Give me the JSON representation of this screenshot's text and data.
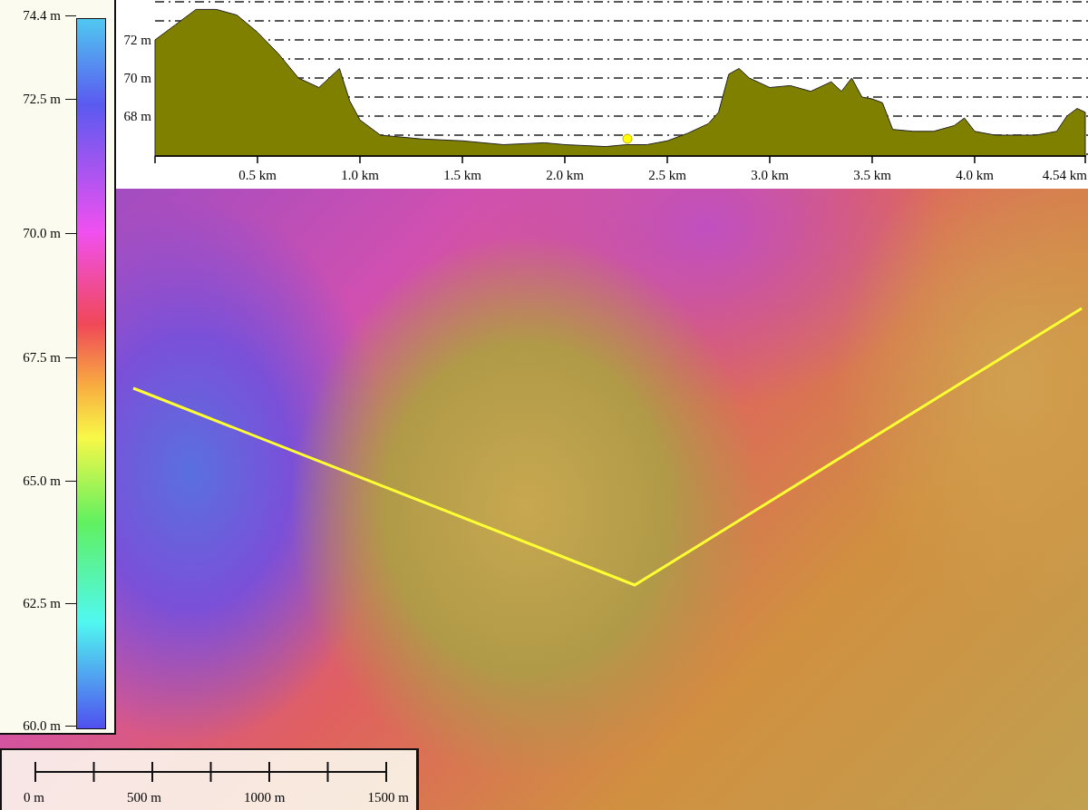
{
  "legend": {
    "labels": [
      "74.4 m",
      "72.5 m",
      "70.0 m",
      "67.5 m",
      "65.0 m",
      "62.5 m",
      "60.0 m"
    ]
  },
  "profile": {
    "chart_data": {
      "type": "area",
      "xlim": [
        0,
        4.54
      ],
      "ylim": [
        65.9,
        74.1
      ],
      "x": [
        0,
        0.1,
        0.2,
        0.3,
        0.4,
        0.5,
        0.6,
        0.7,
        0.8,
        0.9,
        0.95,
        1.0,
        1.1,
        1.2,
        1.3,
        1.5,
        1.7,
        1.9,
        2.0,
        2.2,
        2.3,
        2.4,
        2.5,
        2.6,
        2.7,
        2.75,
        2.8,
        2.85,
        2.9,
        3.0,
        3.1,
        3.2,
        3.3,
        3.35,
        3.4,
        3.45,
        3.5,
        3.55,
        3.6,
        3.7,
        3.8,
        3.9,
        3.95,
        4.0,
        4.1,
        4.2,
        4.3,
        4.4,
        4.45,
        4.5,
        4.54
      ],
      "series": [
        {
          "color": "#808000",
          "values": [
            72.0,
            72.8,
            73.6,
            73.6,
            73.3,
            72.4,
            71.3,
            70.0,
            69.5,
            70.5,
            68.8,
            67.8,
            67.0,
            66.9,
            66.8,
            66.7,
            66.5,
            66.6,
            66.5,
            66.4,
            66.5,
            66.5,
            66.7,
            67.1,
            67.6,
            68.2,
            70.2,
            70.5,
            70.0,
            69.5,
            69.6,
            69.3,
            69.8,
            69.3,
            70.0,
            69.0,
            68.9,
            68.7,
            67.3,
            67.2,
            67.2,
            67.5,
            67.9,
            67.2,
            67.0,
            67.0,
            67.0,
            67.2,
            68.0,
            68.4,
            68.2
          ]
        }
      ],
      "yticks": [
        {
          "value": 68,
          "label": "68 m"
        },
        {
          "value": 70,
          "label": "70 m"
        },
        {
          "value": 72,
          "label": "72 m"
        }
      ],
      "grid": true,
      "xticks": [
        {
          "value": 0.5,
          "label": "0.5 km"
        },
        {
          "value": 1.0,
          "label": "1.0 km"
        },
        {
          "value": 1.5,
          "label": "1.5 km"
        },
        {
          "value": 2.0,
          "label": "2.0 km"
        },
        {
          "value": 2.5,
          "label": "2.5 km"
        },
        {
          "value": 3.0,
          "label": "3.0 km"
        },
        {
          "value": 3.5,
          "label": "3.5 km"
        },
        {
          "value": 4.0,
          "label": "4.0 km"
        },
        {
          "value": 4.54,
          "label": "4.54 km"
        }
      ]
    }
  },
  "scale_bar": {
    "labels": [
      "0 m",
      "500 m",
      "1000 m",
      "1500 m"
    ]
  }
}
